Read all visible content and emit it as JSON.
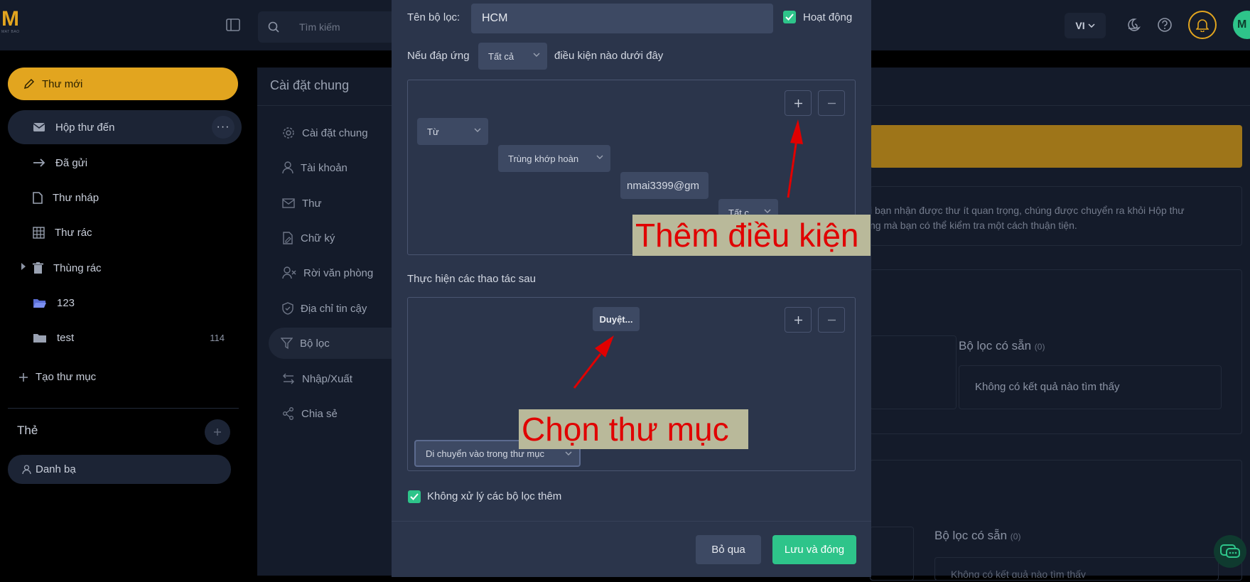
{
  "topbar": {
    "search_placeholder": "Tìm kiếm",
    "lang": "VI",
    "avatar_initial": "M"
  },
  "sidebar": {
    "compose_label": "Thư mới",
    "items": [
      {
        "label": "Hộp thư đến",
        "icon": "inbox-icon"
      },
      {
        "label": "Đã gửi",
        "icon": "arrow-right-icon"
      },
      {
        "label": "Thư nháp",
        "icon": "draft-icon"
      },
      {
        "label": "Thư rác",
        "icon": "spam-icon"
      },
      {
        "label": "Thùng rác",
        "icon": "trash-icon"
      },
      {
        "label": "123",
        "icon": "folder-open-icon"
      },
      {
        "label": "test",
        "icon": "folder-icon",
        "count": "114"
      }
    ],
    "create_folder_label": "Tạo thư mục",
    "tags_title": "Thẻ",
    "tag_items": [
      {
        "label": "Danh bạ"
      }
    ]
  },
  "settings": {
    "title": "Cài đặt chung",
    "items": [
      {
        "label": "Cài đặt chung"
      },
      {
        "label": "Tài khoản"
      },
      {
        "label": "Thư"
      },
      {
        "label": "Chữ ký"
      },
      {
        "label": "Rời văn phòng"
      },
      {
        "label": "Địa chỉ tin cậy"
      },
      {
        "label": "Bộ lọc"
      },
      {
        "label": "Nhập/Xuất"
      },
      {
        "label": "Chia sẻ"
      }
    ],
    "desc_line1": "i bạn nhận được thư ít quan trọng, chúng được chuyển ra khỏi Hộp thư",
    "desc_line2": "ng mà bạn có thể kiểm tra một cách thuận tiện.",
    "available_filters_title": "Bộ lọc có sẵn",
    "available_filters_count": "(0)",
    "empty_text": "Không có kết quả nào tìm thấy",
    "available_filters_title_2": "Bộ lọc có sẵn",
    "available_filters_count_2": "(0)",
    "empty_text_2": "Không có kết quả nào tìm thấy"
  },
  "modal": {
    "name_label": "Tên bộ lọc:",
    "name_value": "HCM",
    "active_label": "Hoạt động",
    "match_prefix": "Nếu đáp ứng",
    "match_value": "Tất cả",
    "match_suffix": "điều kiện nào dưới đây",
    "condition": {
      "field": "Từ",
      "operator": "Trùng khớp hoàn",
      "value": "nmai3399@gm",
      "scope": "Tất c"
    },
    "actions_label": "Thực hiện các thao tác sau",
    "action": {
      "type": "Di chuyển vào trong thư mục",
      "browse_label": "Duyệt..."
    },
    "stop_label": "Không xử lý các bộ lọc thêm",
    "skip_label": "Bỏ qua",
    "save_label": "Lưu và đóng"
  },
  "annotations": {
    "add_condition": "Thêm điều kiện",
    "choose_folder": "Chọn thư mục",
    "color_text": "#e00000",
    "color_bg": "#b9b99a"
  },
  "colors": {
    "accent_yellow": "#e2a51f",
    "accent_green": "#2ec48a",
    "modal_bg": "#2b354b"
  }
}
